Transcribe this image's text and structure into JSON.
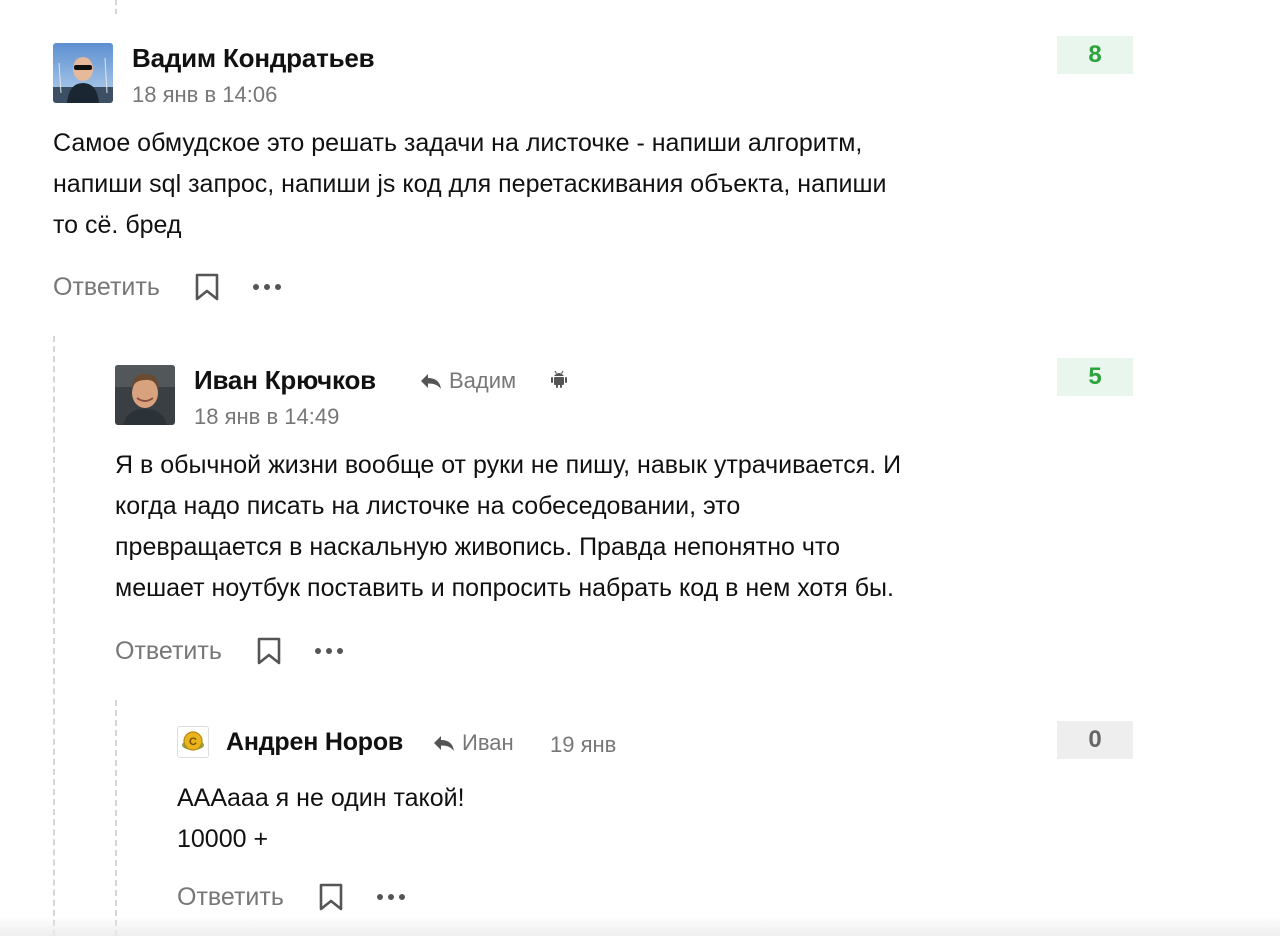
{
  "comments": [
    {
      "author": "Вадим Кондратьев",
      "date": "18 янв в 14:06",
      "score": "8",
      "score_kind": "positive",
      "body_lines": [
        "Самое обмудское это решать задачи на листочке - напиши алгоритм,",
        "напиши sql запрос, напиши js код для перетаскивания объекта, напиши",
        "то сё. бред"
      ],
      "reply_label": "Ответить",
      "avatar_icon": "user-avatar-photo"
    },
    {
      "author": "Иван Крючков",
      "reply_to": "Вадим",
      "date": "18 янв в 14:49",
      "score": "5",
      "score_kind": "positive",
      "platform_icon": "android-icon",
      "body_lines": [
        "Я в обычной жизни вообще от руки не пишу, навык утрачивается. И",
        "когда надо писать на листочке на собеседовании, это",
        "превращается в наскальную живопись. Правда непонятно что",
        "мешает ноутбук поставить и попросить набрать код в нем хотя бы."
      ],
      "reply_label": "Ответить",
      "avatar_icon": "user-avatar-photo"
    },
    {
      "author": "Андрен Норов",
      "reply_to": "Иван",
      "date": "19 янв",
      "score": "0",
      "score_kind": "neutral",
      "body_lines": [
        "ААAааа я не один такой!",
        "10000 +"
      ],
      "reply_label": "Ответить",
      "avatar_icon": "user-avatar-coin"
    }
  ],
  "colors": {
    "positive_score_bg": "#e9f6ee",
    "positive_score_text": "#2ca33c",
    "neutral_score_bg": "#eeeeee",
    "neutral_score_text": "#666666",
    "muted_text": "#777777"
  }
}
